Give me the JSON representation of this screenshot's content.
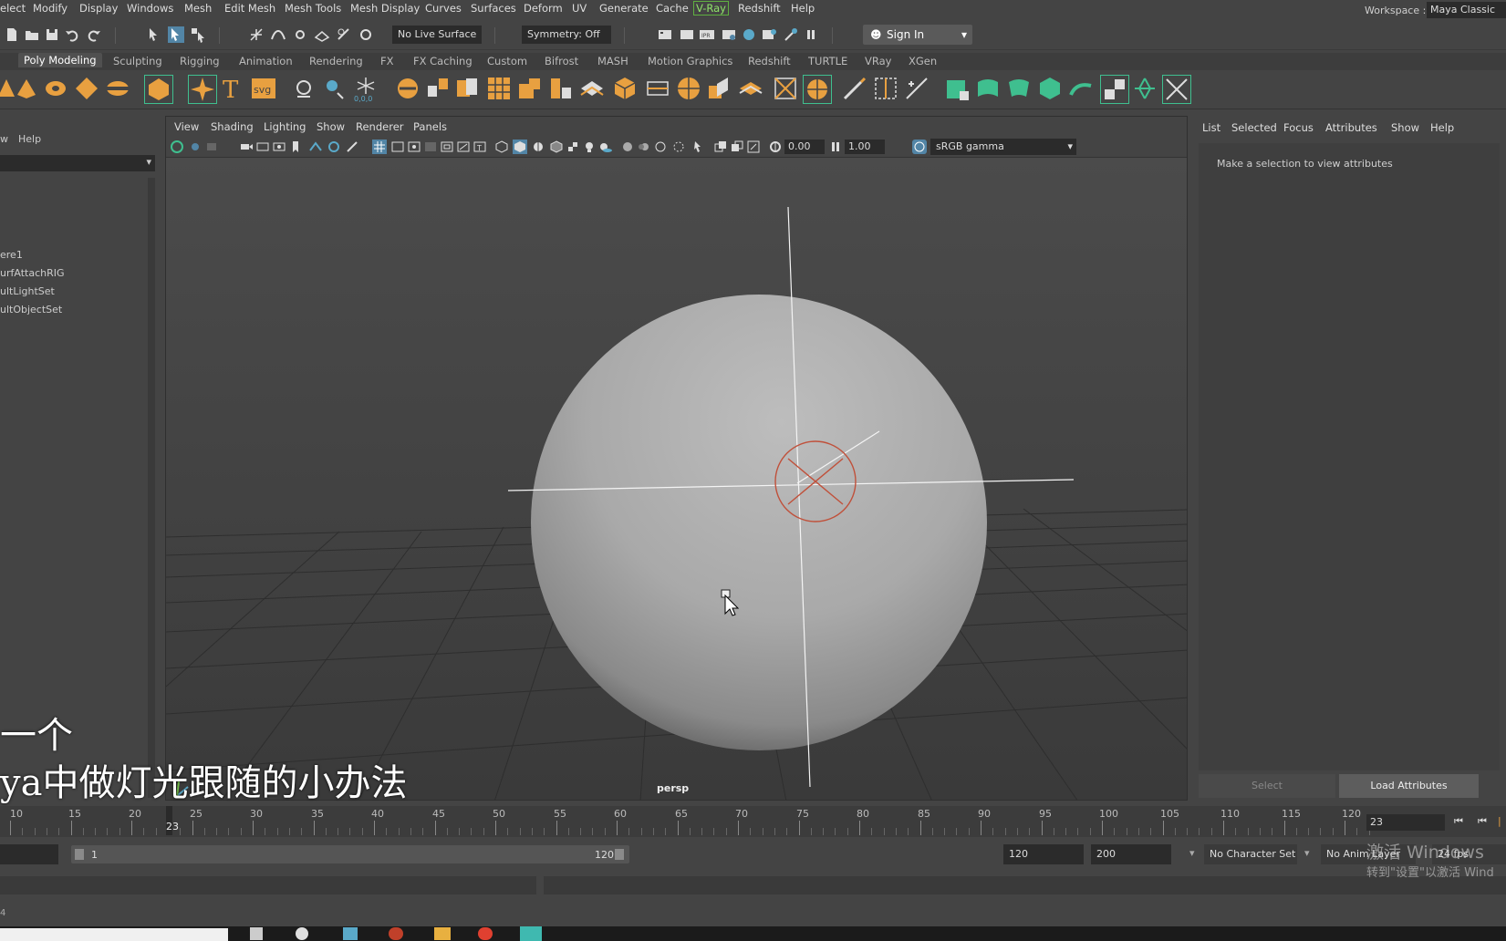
{
  "menubar": {
    "items": [
      "elect",
      "Modify",
      "Display",
      "Windows",
      "Mesh",
      "Edit Mesh",
      "Mesh Tools",
      "Mesh Display",
      "Curves",
      "Surfaces",
      "Deform",
      "UV",
      "Generate",
      "Cache",
      "V-Ray",
      "Redshift",
      "Help"
    ],
    "workspace_label": "Workspace :",
    "workspace_value": "Maya Classic"
  },
  "statusline": {
    "live_surface": "No Live Surface",
    "symmetry": "Symmetry: Off",
    "sign_in": "Sign In"
  },
  "shelf": {
    "tabs": [
      "Poly Modeling",
      "Sculpting",
      "Rigging",
      "Animation",
      "Rendering",
      "FX",
      "FX Caching",
      "Custom",
      "Bifrost",
      "MASH",
      "Motion Graphics",
      "Redshift",
      "TURTLE",
      "VRay",
      "XGen"
    ],
    "active_tab": "Poly Modeling",
    "text_icon": "T",
    "svg_icon": "svg"
  },
  "outliner": {
    "menu": [
      "w",
      "Help"
    ],
    "items": [
      "ere1",
      "urfAttachRIG",
      "ultLightSet",
      "ultObjectSet"
    ]
  },
  "viewport": {
    "menu": [
      "View",
      "Shading",
      "Lighting",
      "Show",
      "Renderer",
      "Panels"
    ],
    "exposure": "0.00",
    "gamma": "1.00",
    "color_space": "sRGB gamma",
    "camera": "persp",
    "selected_object": "pointLight (red circle manipulator)"
  },
  "attribute_editor": {
    "menu": [
      "List",
      "Selected",
      "Focus",
      "Attributes",
      "Show",
      "Help"
    ],
    "message": "Make a selection to view attributes",
    "select_button": "Select",
    "load_button": "Load Attributes"
  },
  "timeslider": {
    "labels": [
      "10",
      "15",
      "20",
      "25",
      "30",
      "35",
      "40",
      "45",
      "50",
      "55",
      "60",
      "65",
      "70",
      "75",
      "80",
      "85",
      "90",
      "95",
      "100",
      "105",
      "110",
      "115",
      "120"
    ],
    "current_frame": "23"
  },
  "rangeslider": {
    "start": "1",
    "end": "120",
    "end_field": "120",
    "max_field": "200",
    "character_set": "No Character Set",
    "anim_layer": "No Anim Layer",
    "fps": "24 fps"
  },
  "helpline": {
    "text": "4"
  },
  "overlays": {
    "subtitle_line1": "一个",
    "subtitle_line2": "ya中做灯光跟随的小办法",
    "watermark_line1": "激活 Windows",
    "watermark_line2": "转到\"设置\"以激活 Wind"
  },
  "colors": {
    "accent": "#5285a6",
    "vray_green": "#8fe36a",
    "light_red": "#c0503a",
    "shelf_orange": "#e8a040",
    "shelf_green": "#3fbf8f"
  }
}
